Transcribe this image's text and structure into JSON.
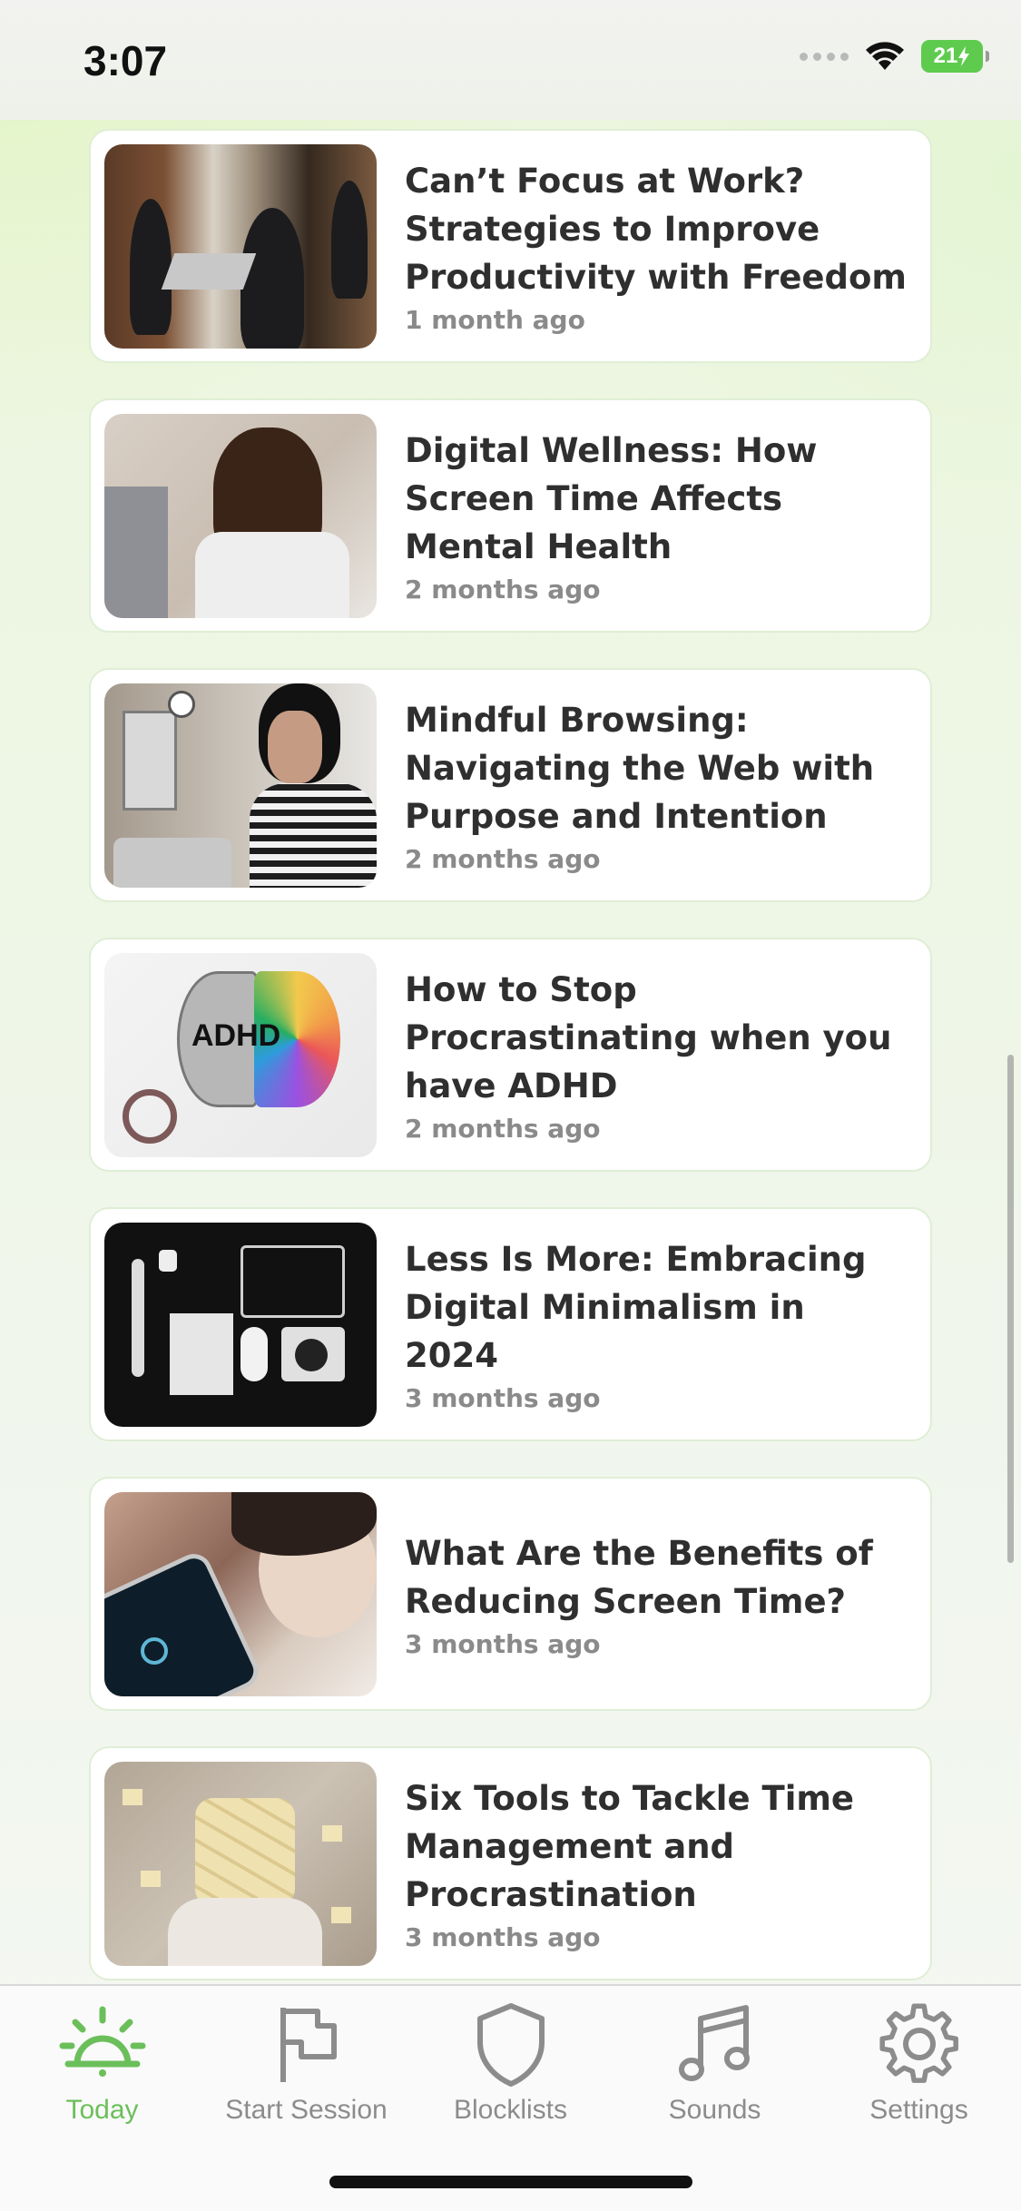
{
  "status_bar": {
    "time": "3:07",
    "battery": "21"
  },
  "articles": [
    {
      "title": "Can’t Focus at Work? Strategies to Improve Productivity with Freedom",
      "date": "1 month ago",
      "image": "office-team-photo"
    },
    {
      "title": "Digital Wellness: How Screen Time Affects Mental Health",
      "date": "2 months ago",
      "image": "stressed-man-laptop-photo"
    },
    {
      "title": "Mindful Browsing: Navigating the Web with Purpose and Intention",
      "date": "2 months ago",
      "image": "woman-phone-photo"
    },
    {
      "title": "How to Stop Procrastinating when you have ADHD",
      "date": "2 months ago",
      "image": "adhd-brain-illustration",
      "image_text": "ADHD"
    },
    {
      "title": "Less Is More: Embracing Digital Minimalism in 2024",
      "date": "3 months ago",
      "image": "devices-flatlay-photo"
    },
    {
      "title": "What Are the Benefits of Reducing Screen Time?",
      "date": "3 months ago",
      "image": "person-phone-bed-photo"
    },
    {
      "title": "Six Tools to Tackle Time Management and Procrastination",
      "date": "3 months ago",
      "image": "sticky-notes-person-photo"
    }
  ],
  "tab_bar": {
    "active_color": "#6bbf5a",
    "inactive_color": "#8c8c8c",
    "tabs": [
      {
        "label": "Today",
        "icon": "sunrise-alarm-icon",
        "active": true
      },
      {
        "label": "Start Session",
        "icon": "flag-icon",
        "active": false
      },
      {
        "label": "Blocklists",
        "icon": "shield-icon",
        "active": false
      },
      {
        "label": "Sounds",
        "icon": "music-note-icon",
        "active": false
      },
      {
        "label": "Settings",
        "icon": "gear-icon",
        "active": false
      }
    ]
  }
}
